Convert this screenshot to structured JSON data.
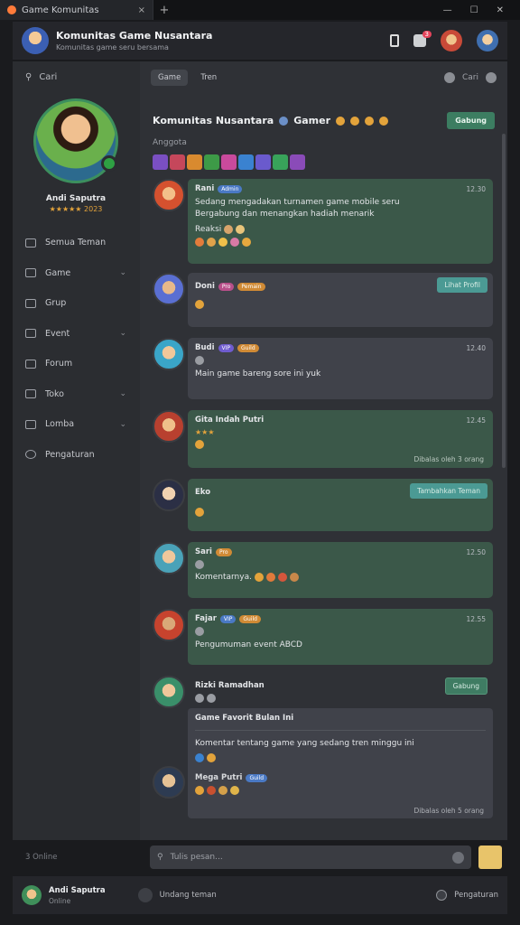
{
  "tab": {
    "title": "Game Komunitas",
    "new_tab": "+",
    "close": "×"
  },
  "window_controls": [
    "—",
    "☐",
    "✕"
  ],
  "header": {
    "title": "Komunitas Game Nusantara",
    "subtitle": "Komunitas game seru bersama",
    "notif_count": "3",
    "icons": [
      "window-icon",
      "bell-icon",
      "avatar-1",
      "avatar-2"
    ]
  },
  "sidebar": {
    "search_label": "Cari",
    "profile": {
      "name": "Andi Saputra",
      "rating": "★★★★★ 2023"
    },
    "items": [
      {
        "label": "Semua Teman",
        "chevron": ""
      },
      {
        "label": "Game",
        "chevron": "⌄"
      },
      {
        "label": "Grup",
        "chevron": ""
      },
      {
        "label": "Event",
        "chevron": "⌄"
      },
      {
        "label": "Forum",
        "chevron": ""
      },
      {
        "label": "Toko",
        "chevron": "⌄"
      },
      {
        "label": "Lomba",
        "chevron": "⌄"
      },
      {
        "label": "Pengaturan",
        "chevron": ""
      }
    ]
  },
  "filters": {
    "chips": [
      "Game",
      "Tren"
    ],
    "right_label": "Cari"
  },
  "community": {
    "title": "Komunitas Nusantara",
    "title_suffix": "Gamer",
    "join_label": "Gabung",
    "subtitle": "Anggota"
  },
  "messages": [
    {
      "name": "Rani",
      "pill1": "Admin",
      "time": "12.30",
      "lines": [
        "Sedang mengadakan turnamen game mobile seru",
        "Bergabung dan menangkan hadiah menarik"
      ],
      "caption": "Reaksi"
    },
    {
      "name": "Doni",
      "pill1": "Pro",
      "pill2": "Pemain",
      "action": "Lihat Profil"
    },
    {
      "name": "Budi",
      "pill1": "VIP",
      "pill2": "Guild",
      "time": "12.40",
      "lines": [
        "Main game bareng sore ini yuk"
      ]
    },
    {
      "name": "Gita Indah Putri",
      "time": "12.45",
      "footer": "Dibalas oleh 3 orang"
    },
    {
      "name": "Eko",
      "action": "Tambahkan Teman"
    },
    {
      "name": "Sari",
      "pill1": "Pro",
      "time": "12.50",
      "lines": [
        "Komentarnya."
      ]
    },
    {
      "name": "Fajar",
      "pill1": "VIP",
      "pill2": "Guild",
      "time": "12.55",
      "lines": [
        "Pengumuman event ABCD"
      ]
    },
    {
      "name": "Rizki Ramadhan",
      "action": "Gabung",
      "quote_title": "Game Favorit Bulan Ini",
      "quote_text": "Komentar tentang game yang sedang tren minggu ini",
      "footer": "Dibalas oleh 5 orang"
    },
    {
      "name": "Mega Putri",
      "pill1": "Guild"
    }
  ],
  "compose": {
    "left": "3 Online",
    "placeholder": "Tulis pesan..."
  },
  "footer": {
    "name": "Andi Saputra",
    "status": "Online",
    "mid_label": "Undang teman",
    "right_label": "Pengaturan"
  },
  "colors": {
    "accent": "#3c7d61",
    "bubble_green": "#3b5849",
    "bubble_grey": "#40424a",
    "bg": "#2f3136"
  }
}
